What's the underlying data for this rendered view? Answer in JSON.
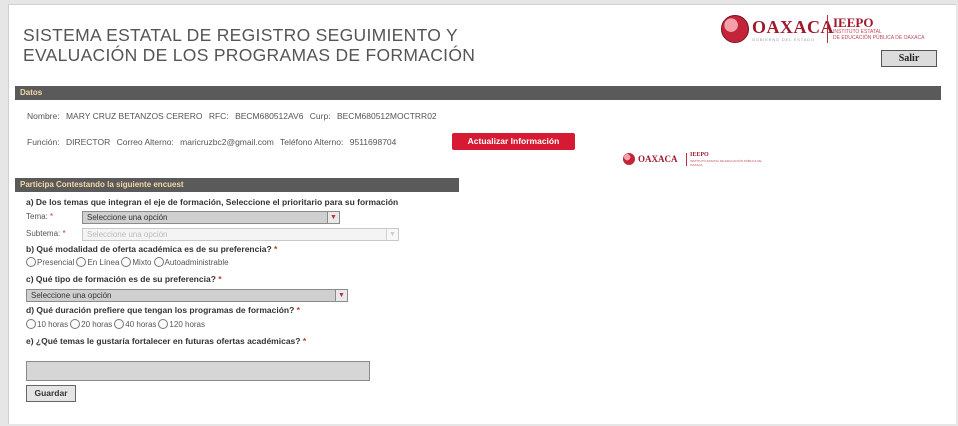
{
  "header": {
    "title": "SISTEMA ESTATAL DE REGISTRO SEGUIMIENTO Y\nEVALUACIÓN DE LOS PROGRAMAS DE FORMACIÓN",
    "logo_word": "OAXACA",
    "logo_sub": "GOBIERNO DEL ESTADO",
    "ieepo": "IEEPO",
    "ieepo_sub": "INSTITUTO ESTATAL\nDE EDUCACIÓN PÚBLICA DE OAXACA",
    "salir": "Salir"
  },
  "datos": {
    "bar_title": "Datos",
    "nombre_label": "Nombre:",
    "nombre": "MARY CRUZ BETANZOS CERERO",
    "rfc_label": "RFC:",
    "rfc": "BECM680512AV6",
    "curp_label": "Curp:",
    "curp": "BECM680512MOCTRR02",
    "funcion_label": "Función:",
    "funcion": "DIRECTOR",
    "correo_label": "Correo Alterno:",
    "correo": "maricruzbc2@gmail.com",
    "telefono_label": "Teléfono Alterno:",
    "telefono": "9511698704",
    "update_button": "Actualizar Información"
  },
  "encuesta": {
    "bar_title": "Participa Contestando la siguiente encuest",
    "q_a": "a) De los temas que integran el eje de formación, Seleccione el prioritario para su formación",
    "tema_label": "Tema:",
    "tema_value": "Seleccione una opción",
    "subtema_label": "Subtema:",
    "subtema_value": "Seleccione una opción",
    "q_b": "b) Qué modalidad de oferta académica es de su preferencia?",
    "modalidades": [
      "Presencial",
      "En Línea",
      "Mixto",
      "Autoadministrable"
    ],
    "q_c": "c) Qué tipo de formación es de su preferencia?",
    "tipo_value": "Seleccione una opción",
    "q_d": "d) Qué duración prefiere que tengan los programas de formación?",
    "duraciones": [
      "10 horas",
      "20 horas",
      "40 horas",
      "120 horas"
    ],
    "q_e": "e) ¿Qué temas le gustaría fortalecer en futuras ofertas académicas?",
    "required_mark": "*",
    "guardar": "Guardar"
  },
  "icons": {
    "dropdown": "chevron-down-icon",
    "radio": "radio-icon"
  },
  "colors": {
    "accent_red": "#d71a34",
    "bar_gray": "#5a5a5a",
    "bar_text": "#f3d8a6"
  }
}
